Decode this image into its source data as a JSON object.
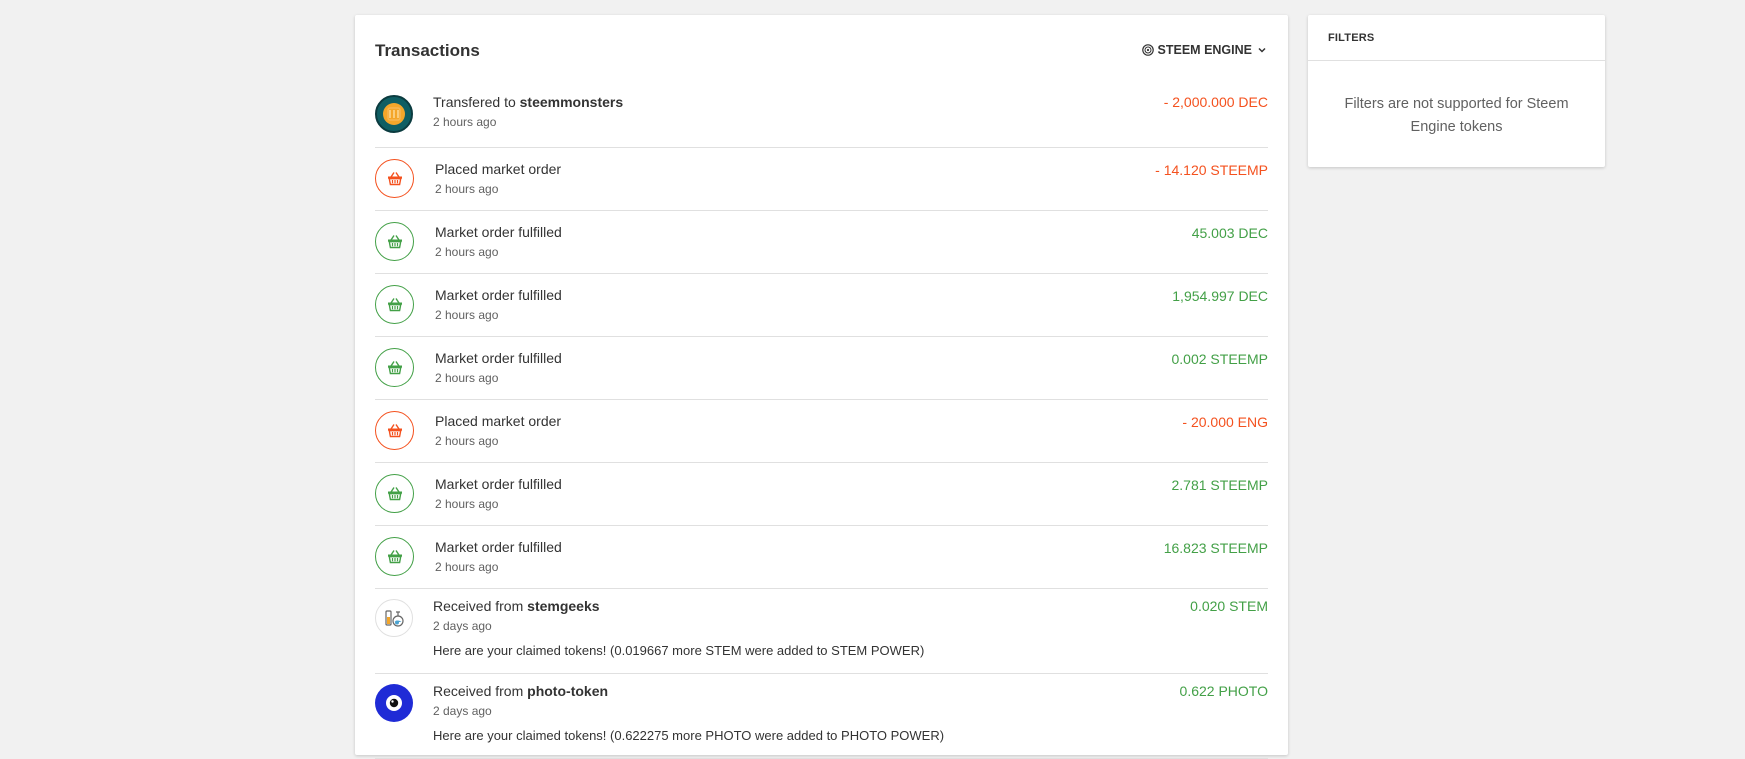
{
  "transactions": {
    "title": "Transactions",
    "source_select": {
      "label": "STEEM ENGINE",
      "icon": "steem-engine-logo-icon",
      "chevron": "chevron-down-icon"
    },
    "colors": {
      "negative": "#f4511e",
      "positive": "#43a047"
    },
    "rows": [
      {
        "icon": "splinterlands-avatar",
        "label": "Transfered to",
        "party": "steemmonsters",
        "time": "2 hours ago",
        "amount": "- 2,000.000 DEC",
        "sign": "negative"
      },
      {
        "icon": "basket-icon",
        "label": "Placed market order",
        "time": "2 hours ago",
        "amount": "- 14.120 STEEMP",
        "sign": "negative"
      },
      {
        "icon": "basket-icon",
        "label": "Market order fulfilled",
        "time": "2 hours ago",
        "amount": "45.003 DEC",
        "sign": "positive"
      },
      {
        "icon": "basket-icon",
        "label": "Market order fulfilled",
        "time": "2 hours ago",
        "amount": "1,954.997 DEC",
        "sign": "positive"
      },
      {
        "icon": "basket-icon",
        "label": "Market order fulfilled",
        "time": "2 hours ago",
        "amount": "0.002 STEEMP",
        "sign": "positive"
      },
      {
        "icon": "basket-icon",
        "label": "Placed market order",
        "time": "2 hours ago",
        "amount": "- 20.000 ENG",
        "sign": "negative"
      },
      {
        "icon": "basket-icon",
        "label": "Market order fulfilled",
        "time": "2 hours ago",
        "amount": "2.781 STEEMP",
        "sign": "positive"
      },
      {
        "icon": "basket-icon",
        "label": "Market order fulfilled",
        "time": "2 hours ago",
        "amount": "16.823 STEEMP",
        "sign": "positive"
      },
      {
        "icon": "stemgeeks-avatar",
        "label": "Received from",
        "party": "stemgeeks",
        "time": "2 days ago",
        "memo": "Here are your claimed tokens! (0.019667 more STEM were added to STEM POWER)",
        "amount": "0.020 STEM",
        "sign": "positive"
      },
      {
        "icon": "photo-token-avatar",
        "label": "Received from",
        "party": "photo-token",
        "time": "2 days ago",
        "memo": "Here are your claimed tokens! (0.622275 more PHOTO were added to PHOTO POWER)",
        "amount": "0.622 PHOTO",
        "sign": "positive"
      }
    ]
  },
  "filters": {
    "title": "FILTERS",
    "message": "Filters are not supported for Steem Engine tokens"
  }
}
